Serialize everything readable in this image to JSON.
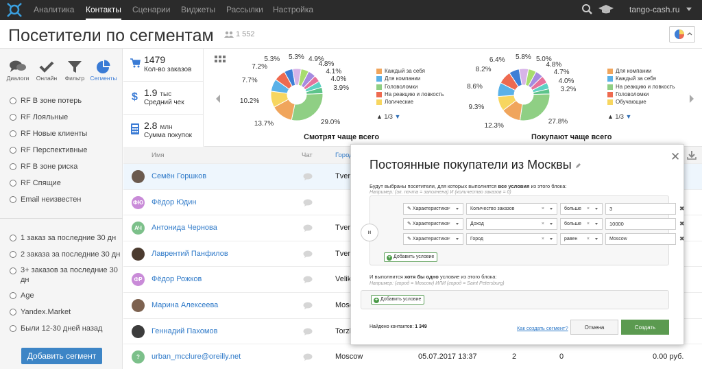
{
  "nav": {
    "items": [
      {
        "label": "Аналитика"
      },
      {
        "label": "Контакты"
      },
      {
        "label": "Сценарии"
      },
      {
        "label": "Виджеты"
      },
      {
        "label": "Рассылки"
      },
      {
        "label": "Настройка"
      }
    ],
    "active": "Контакты",
    "account": "tango-cash.ru"
  },
  "page": {
    "title": "Посетители по сегментам",
    "count": "1 552"
  },
  "sidebar": {
    "tabs": [
      {
        "label": "Диалоги",
        "icon": "chat-bubbles-icon"
      },
      {
        "label": "Онлайн",
        "icon": "checkmark-icon"
      },
      {
        "label": "Фильтр",
        "icon": "funnel-icon"
      },
      {
        "label": "Сегменты",
        "icon": "pie-chart-icon"
      }
    ],
    "active_tab": "Сегменты",
    "segments_a": [
      "RF В зоне потерь",
      "RF Лояльные",
      "RF Новые клиенты",
      "RF Перспективные",
      "RF В зоне риска",
      "RF Спящие",
      "Email неизвестен"
    ],
    "segments_b": [
      "1 заказ за последние 30 дн",
      "2 заказа за последние 30 дн",
      "3+ заказов за последние 30 дн",
      "Age",
      "Yandex.Market",
      "Были 12-30 дней назад"
    ],
    "add_button": "Добавить сегмент"
  },
  "stats": [
    {
      "value": "1479",
      "unit": "",
      "label": "Кол-во заказов",
      "icon": "cart-icon"
    },
    {
      "value": "1.9",
      "unit": "тыс",
      "label": "Средний чек",
      "icon": "dollar-icon"
    },
    {
      "value": "2.8",
      "unit": "млн",
      "label": "Сумма покупок",
      "icon": "calculator-icon"
    }
  ],
  "charts": {
    "left": {
      "title": "Смотрят чаще всего",
      "legend": [
        "Каждый за себя",
        "Для компании",
        "Головоломки",
        "На реакцию и ловкость",
        "Логические"
      ],
      "pager": "1/3"
    },
    "right": {
      "title": "Покупают чаще всего",
      "legend": [
        "Для компании",
        "Каждый за себя",
        "На реакцию и ловкость",
        "Головоломки",
        "Обучающие"
      ],
      "pager": "1/3"
    }
  },
  "chart_data": [
    {
      "type": "pie",
      "title": "Смотрят чаще всего",
      "values": [
        29.0,
        13.7,
        10.2,
        7.7,
        7.2,
        5.3,
        5.3,
        4.9,
        4.8,
        4.1,
        4.0,
        3.9
      ],
      "labels": [
        "29.0%",
        "13.7%",
        "10.2%",
        "7.7%",
        "7.2%",
        "5.3%",
        "5.3%",
        "4.9%",
        "4.8%",
        "4.1%",
        "4.0%",
        "3.9%"
      ],
      "legend_visible": [
        "Каждый за себя",
        "Для компании",
        "Головоломки",
        "На реакцию и ловкость",
        "Логические"
      ],
      "colors": [
        "#8fcf84",
        "#f0a55c",
        "#f7d660",
        "#5ab1e8",
        "#ee6a50",
        "#3e7fd6",
        "#d7b4e8",
        "#a7dd6f",
        "#a58be0",
        "#e6729c",
        "#5ed1c3",
        "#5dc48a"
      ]
    },
    {
      "type": "pie",
      "title": "Покупают чаще всего",
      "values": [
        27.8,
        12.3,
        9.3,
        8.6,
        8.2,
        6.4,
        5.8,
        5.0,
        4.8,
        4.7,
        4.0,
        3.2
      ],
      "labels": [
        "27.8%",
        "12.3%",
        "9.3%",
        "8.6%",
        "8.2%",
        "6.4%",
        "5.8%",
        "5.0%",
        "4.8%",
        "4.7%",
        "4.0%",
        "3.2%"
      ],
      "legend_visible": [
        "Для компании",
        "Каждый за себя",
        "На реакцию и ловкость",
        "Головоломки",
        "Обучающие"
      ],
      "colors": [
        "#8fcf84",
        "#f0a55c",
        "#f7d660",
        "#5ab1e8",
        "#ee6a50",
        "#3e7fd6",
        "#d7b4e8",
        "#a7dd6f",
        "#a58be0",
        "#e6729c",
        "#5ed1c3",
        "#5dc48a"
      ]
    }
  ],
  "table": {
    "headers": [
      "Имя",
      "Чат",
      "Город"
    ],
    "rows": [
      {
        "name": "Семён Горшков",
        "initials": "",
        "avatar_color": "#6b5a4e",
        "city": "Tver",
        "highlight": true
      },
      {
        "name": "Фёдор Юдин",
        "initials": "ФЮ",
        "avatar_color": "#c98bd8",
        "city": ""
      },
      {
        "name": "Антонида Чернова",
        "initials": "АЧ",
        "avatar_color": "#7cc08a",
        "city": "Tver"
      },
      {
        "name": "Лаврентий Панфилов",
        "initials": "",
        "avatar_color": "#4b3b2f",
        "city": "Tver"
      },
      {
        "name": "Фёдор Рожков",
        "initials": "ФР",
        "avatar_color": "#c98bd8",
        "city": "Veliki"
      },
      {
        "name": "Марина Алексеева",
        "initials": "",
        "avatar_color": "#7d6250",
        "city": "Mosco"
      },
      {
        "name": "Геннадий Пахомов",
        "initials": "",
        "avatar_color": "#3c3c3c",
        "city": "Torzh"
      },
      {
        "name": "urban_mcclure@oreilly.net",
        "initials": "?",
        "avatar_color": "#7cc08a",
        "city": "Moscow",
        "date": "05.07.2017 13:37",
        "orders": "2",
        "v2": "0",
        "sum": "0.00 руб."
      }
    ]
  },
  "modal": {
    "title": "Постоянные покупатели из Москвы",
    "desc_pre": "Будут выбраны посетители, для которых выполнятся ",
    "desc_bold": "все условия",
    "desc_post": " из этого блока:",
    "example1": "Например: (эл. почта = заполнена) И (количество заказов = 0)",
    "and_label": "и",
    "conditions": [
      {
        "type": "Характеристика",
        "field": "Количество заказов",
        "op": "больше",
        "value": "3"
      },
      {
        "type": "Характеристика",
        "field": "Доход",
        "op": "больше",
        "value": "10000"
      },
      {
        "type": "Характеристика",
        "field": "Город",
        "op": "равен",
        "value": "Moscow"
      }
    ],
    "add_condition": "Добавить условие",
    "or_pre": "И выполнится ",
    "or_bold": "хотя бы одно",
    "or_post": " условие из этого блока:",
    "example2": "Например: (город = Moscow) ИЛИ (город = Saint Petersburg)",
    "found_label": "Найдено контактов:",
    "found_count": "1 349",
    "how_link": "Как создать сегмент?",
    "cancel": "Отмена",
    "create": "Создать"
  }
}
